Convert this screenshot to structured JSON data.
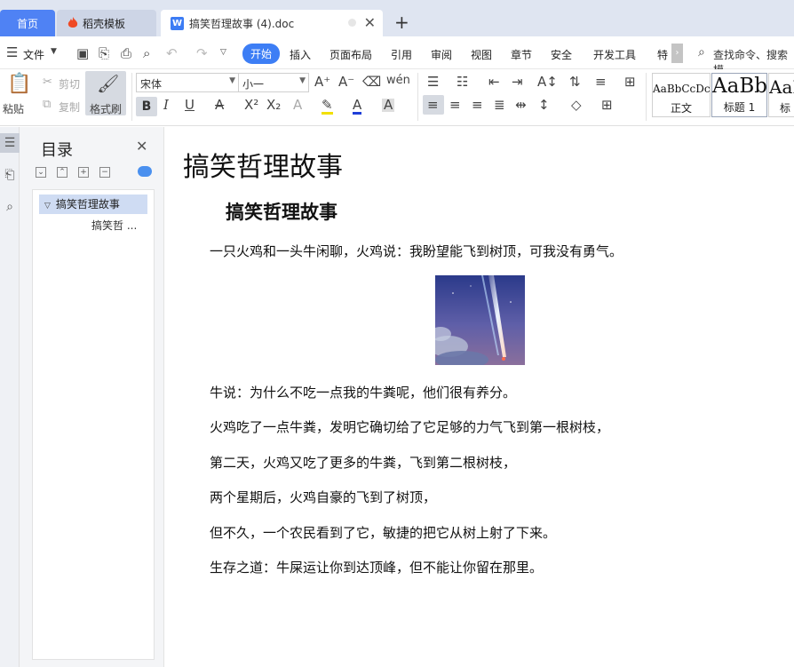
{
  "tabs": {
    "home": "首页",
    "template": "稻壳模板",
    "document": "搞笑哲理故事 (4).doc",
    "doc_icon": "W"
  },
  "menu": {
    "file": "文件",
    "items": [
      "开始",
      "插入",
      "页面布局",
      "引用",
      "审阅",
      "视图",
      "章节",
      "安全",
      "开发工具",
      "特"
    ],
    "search": "查找命令、搜索模"
  },
  "ribbon": {
    "paste": "粘贴",
    "cut": "剪切",
    "copy": "复制",
    "format_painter": "格式刷",
    "font_name": "宋体",
    "font_size": "小一",
    "bold": "B",
    "italic": "I",
    "underline": "U",
    "styles": [
      {
        "preview": "AaBbCcDc",
        "label": "正文"
      },
      {
        "preview": "AaBb",
        "label": "标题 1"
      },
      {
        "preview": "AaI",
        "label": "标"
      }
    ]
  },
  "toc": {
    "title": "目录",
    "items": [
      "搞笑哲理故事",
      "搞笑哲 ..."
    ]
  },
  "document": {
    "title": "搞笑哲理故事",
    "heading": "搞笑哲理故事",
    "paragraphs": [
      "一只火鸡和一头牛闲聊，火鸡说：我盼望能飞到树顶，可我没有勇气。",
      "牛说：为什么不吃一点我的牛粪呢，他们很有养分。",
      "火鸡吃了一点牛粪，发明它确切给了它足够的力气飞到第一根树枝，",
      "第二天，火鸡又吃了更多的牛粪，飞到第二根树枝，",
      "两个星期后，火鸡自豪的飞到了树顶，",
      "但不久，一个农民看到了它，敏捷的把它从树上射了下来。",
      "生存之道：牛屎运让你到达顶峰，但不能让你留在那里。"
    ]
  },
  "colors": {
    "accent": "#3d7ef5",
    "tabbar": "#dfe5f1",
    "toc_selected": "#cfdcf3"
  }
}
